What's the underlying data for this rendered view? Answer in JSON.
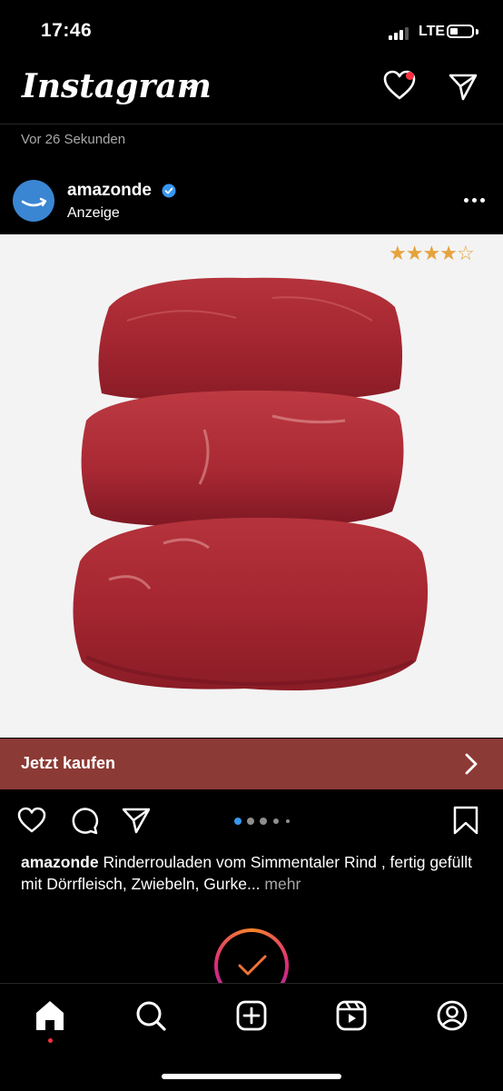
{
  "status_bar": {
    "time": "17:46",
    "network": "LTE"
  },
  "header": {
    "app_title": "Instagram",
    "notification_dot_color": "#ff3040"
  },
  "feed": {
    "time_ago": "Vor 26 Sekunden",
    "post": {
      "username": "amazonde",
      "verified": true,
      "sponsored_label": "Anzeige",
      "rating": {
        "stars_filled": 4,
        "stars_total": 5,
        "star_color": "#e6a23c"
      },
      "image_subject": "beef roulades (Rinderrouladen)",
      "cta": {
        "label": "Jetzt kaufen",
        "color": "#8c3a35"
      },
      "carousel": {
        "count": 5,
        "active": 1
      },
      "caption": {
        "user": "amazonde",
        "text": " Rinderrouladen vom Simmentaler Rind , fertig gefüllt mit Dörrfleisch, Zwiebeln, Gurke...",
        "more": " mehr"
      }
    }
  },
  "icons": {
    "header": [
      "chevron-down-icon",
      "heart-icon",
      "paper-plane-icon"
    ],
    "actions": [
      "heart-icon",
      "comment-icon",
      "share-icon",
      "bookmark-icon"
    ],
    "nav": [
      "home-icon",
      "search-icon",
      "create-icon",
      "reels-icon",
      "profile-icon"
    ]
  }
}
